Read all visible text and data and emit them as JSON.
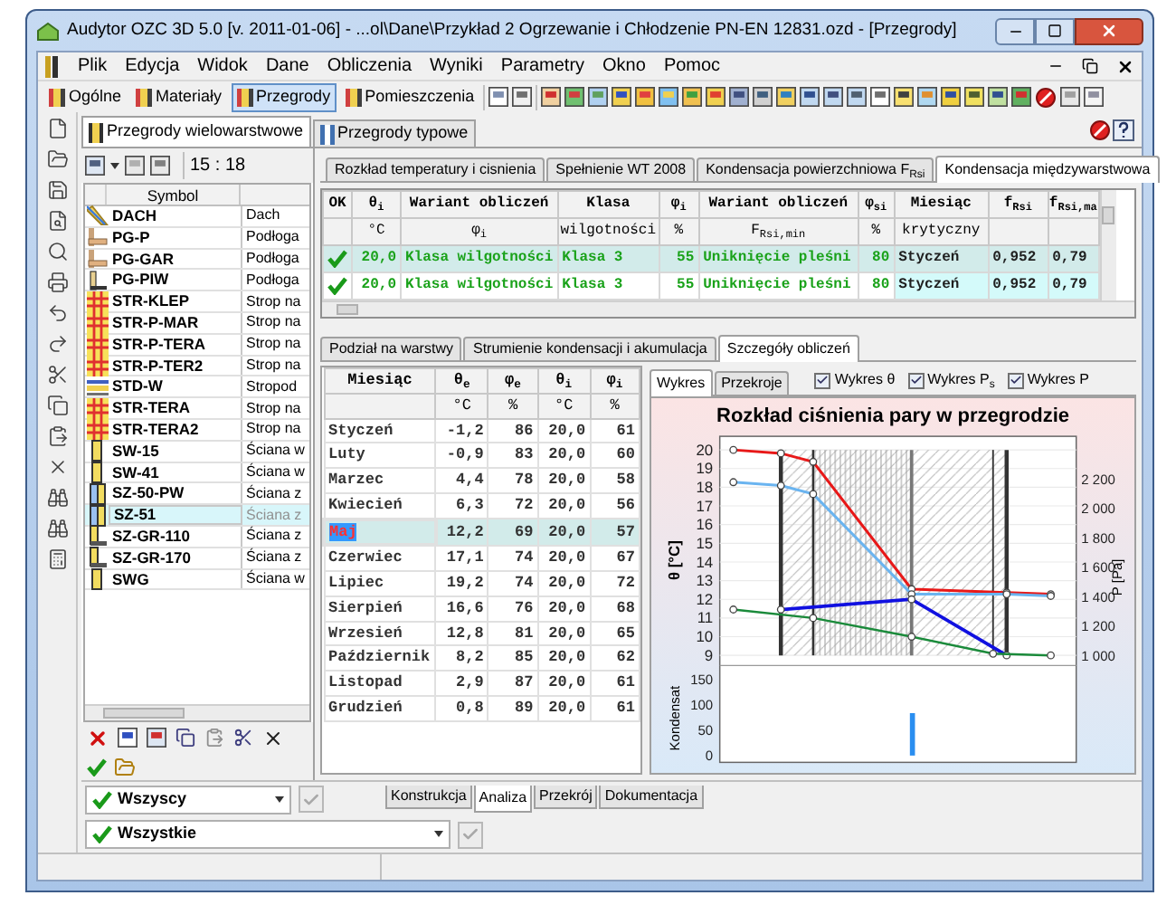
{
  "window": {
    "title": "Audytor OZC 3D 5.0  [v. 2011-01-06] - ...ol\\Dane\\Przykład 2 Ogrzewanie i Chłodzenie PN-EN 12831.ozd - [Przegrody]"
  },
  "menu": [
    "Plik",
    "Edycja",
    "Widok",
    "Dane",
    "Obliczenia",
    "Wyniki",
    "Parametry",
    "Okno",
    "Pomoc"
  ],
  "toolbar": [
    {
      "label": "Ogólne",
      "selected": false
    },
    {
      "label": "Materiały",
      "selected": false
    },
    {
      "label": "Przegrody",
      "selected": true
    },
    {
      "label": "Pomieszczenia",
      "selected": false
    }
  ],
  "left_panel": {
    "tabs": [
      {
        "label": "Przegrody wielowarstwowe",
        "selected": true
      },
      {
        "label": "Przegrody typowe",
        "selected": false
      }
    ],
    "time": "15 : 18",
    "column": "Symbol",
    "rows": [
      {
        "kind": "roof",
        "symbol": "DACH",
        "description": "Dach",
        "selected": false
      },
      {
        "kind": "floor",
        "symbol": "PG-P",
        "description": "Podłoga",
        "selected": false
      },
      {
        "kind": "floor",
        "symbol": "PG-GAR",
        "description": "Podłoga",
        "selected": false
      },
      {
        "kind": "floor-ground",
        "symbol": "PG-PIW",
        "description": "Podłoga",
        "selected": false
      },
      {
        "kind": "ceiling",
        "symbol": "STR-KLEP",
        "description": "Strop na",
        "selected": false
      },
      {
        "kind": "ceiling",
        "symbol": "STR-P-MAR",
        "description": "Strop na",
        "selected": false
      },
      {
        "kind": "ceiling",
        "symbol": "STR-P-TERA",
        "description": "Strop na",
        "selected": false
      },
      {
        "kind": "ceiling",
        "symbol": "STR-P-TER2",
        "description": "Strop na",
        "selected": false
      },
      {
        "kind": "flat-roof",
        "symbol": "STD-W",
        "description": "Stropod",
        "selected": false
      },
      {
        "kind": "ceiling",
        "symbol": "STR-TERA",
        "description": "Strop na",
        "selected": false
      },
      {
        "kind": "ceiling",
        "symbol": "STR-TERA2",
        "description": "Strop na",
        "selected": false
      },
      {
        "kind": "wall",
        "symbol": "SW-15",
        "description": "Ściana w",
        "selected": false
      },
      {
        "kind": "wall",
        "symbol": "SW-41",
        "description": "Ściana w",
        "selected": false
      },
      {
        "kind": "wall-ext",
        "symbol": "SZ-50-PW",
        "description": "Ściana z",
        "selected": false
      },
      {
        "kind": "wall-ext",
        "symbol": "SZ-51",
        "description": "Ściana z",
        "selected": true
      },
      {
        "kind": "wall-ground",
        "symbol": "SZ-GR-110",
        "description": "Ściana z",
        "selected": false
      },
      {
        "kind": "wall-ground",
        "symbol": "SZ-GR-170",
        "description": "Ściana z",
        "selected": false
      },
      {
        "kind": "wall",
        "symbol": "SWG",
        "description": "Ściana w",
        "selected": false
      }
    ]
  },
  "filters": [
    "Wszyscy",
    "Wszystkie"
  ],
  "results": {
    "tabs": [
      {
        "label": "Rozkład temperatury i cisnienia",
        "selected": false
      },
      {
        "label": "Spełnienie WT 2008",
        "selected": false
      },
      {
        "label": "Kondensacja powierzchniowa F$_{Rsi}$",
        "selected": false
      },
      {
        "label": "Kondensacja międzywarstwowa",
        "selected": true
      }
    ],
    "summary_columns": [
      {
        "title": "OK"
      },
      {
        "title": "θ$_{i}$",
        "unit": "°C"
      },
      {
        "title": "Wariant obliczeń",
        "unit": "φ$_{i}$"
      },
      {
        "title": "Klasa",
        "unit": "wilgotności"
      },
      {
        "title": "φ$_{i}$",
        "unit": "%"
      },
      {
        "title": "Wariant obliczeń",
        "unit": "F$_{Rsi,min}$"
      },
      {
        "title": "φ$_{si}$",
        "unit": "%"
      },
      {
        "title": "Miesiąc",
        "unit": "krytyczny"
      },
      {
        "title": "f$_{Rsi}$"
      },
      {
        "title": "f$_{Rsi,ma}$"
      }
    ],
    "summary_rows": [
      {
        "ok": true,
        "selected": true,
        "cells": [
          "20,0",
          "Klasa wilgotności",
          "Klasa 3",
          "55",
          "Uniknięcie pleśni",
          "80",
          "Styczeń",
          "0,952",
          "0,79"
        ]
      },
      {
        "ok": true,
        "selected": false,
        "cells": [
          "20,0",
          "Klasa wilgotności",
          "Klasa 3",
          "55",
          "Uniknięcie pleśni",
          "80",
          "Styczeń",
          "0,952",
          "0,79"
        ]
      }
    ],
    "detail_tabs": [
      {
        "label": "Podział na warstwy",
        "selected": false
      },
      {
        "label": "Strumienie kondensacji i akumulacja",
        "selected": false
      },
      {
        "label": "Szczegóły obliczeń",
        "selected": true
      }
    ],
    "month_columns": [
      {
        "title": "Miesiąc"
      },
      {
        "title": "θ$_{e}$",
        "unit": "°C"
      },
      {
        "title": "φ$_{e}$",
        "unit": "%"
      },
      {
        "title": "θ$_{i}$",
        "unit": "°C"
      },
      {
        "title": "φ$_{i}$",
        "unit": "%"
      }
    ],
    "month_rows": [
      {
        "selected": false,
        "cells": [
          "Styczeń",
          "-1,2",
          "86",
          "20,0",
          "61"
        ]
      },
      {
        "selected": false,
        "cells": [
          "Luty",
          "-0,9",
          "83",
          "20,0",
          "60"
        ]
      },
      {
        "selected": false,
        "cells": [
          "Marzec",
          "4,4",
          "78",
          "20,0",
          "58"
        ]
      },
      {
        "selected": false,
        "cells": [
          "Kwiecień",
          "6,3",
          "72",
          "20,0",
          "56"
        ]
      },
      {
        "selected": true,
        "cells": [
          "Maj",
          "12,2",
          "69",
          "20,0",
          "57"
        ]
      },
      {
        "selected": false,
        "cells": [
          "Czerwiec",
          "17,1",
          "74",
          "20,0",
          "67"
        ]
      },
      {
        "selected": false,
        "cells": [
          "Lipiec",
          "19,2",
          "74",
          "20,0",
          "72"
        ]
      },
      {
        "selected": false,
        "cells": [
          "Sierpień",
          "16,6",
          "76",
          "20,0",
          "68"
        ]
      },
      {
        "selected": false,
        "cells": [
          "Wrzesień",
          "12,8",
          "81",
          "20,0",
          "65"
        ]
      },
      {
        "selected": false,
        "cells": [
          "Październik",
          "8,2",
          "85",
          "20,0",
          "62"
        ]
      },
      {
        "selected": false,
        "cells": [
          "Listopad",
          "2,9",
          "87",
          "20,0",
          "61"
        ]
      },
      {
        "selected": false,
        "cells": [
          "Grudzień",
          "0,8",
          "89",
          "20,0",
          "61"
        ]
      }
    ],
    "chart": {
      "tabs": [
        {
          "label": "Wykres",
          "selected": true
        },
        {
          "label": "Przekroje",
          "selected": false
        }
      ],
      "checkboxes": [
        {
          "label": "Wykres θ",
          "checked": true
        },
        {
          "label": "Wykres P$_{s}$",
          "checked": true
        },
        {
          "label": "Wykres P",
          "checked": true
        }
      ],
      "title": "Rozkład ciśnienia pary w przegrodzie",
      "ylabel": "θ [°C]",
      "y2label": "P [Pa]",
      "y3label": "Kondensat",
      "yticks": [
        "20",
        "19",
        "18",
        "17",
        "16",
        "15",
        "14",
        "13",
        "12",
        "11",
        "10",
        "9"
      ],
      "y2ticks": [
        "2 200",
        "2 000",
        "1 800",
        "1 600",
        "1 400",
        "1 200",
        "1 000"
      ],
      "y3ticks": [
        "150",
        "100",
        "50",
        "0"
      ]
    }
  },
  "bottom_tabs": [
    {
      "label": "Konstrukcja",
      "selected": false
    },
    {
      "label": "Analiza",
      "selected": true
    },
    {
      "label": "Przekrój",
      "selected": false
    },
    {
      "label": "Dokumentacja",
      "selected": false
    }
  ]
}
